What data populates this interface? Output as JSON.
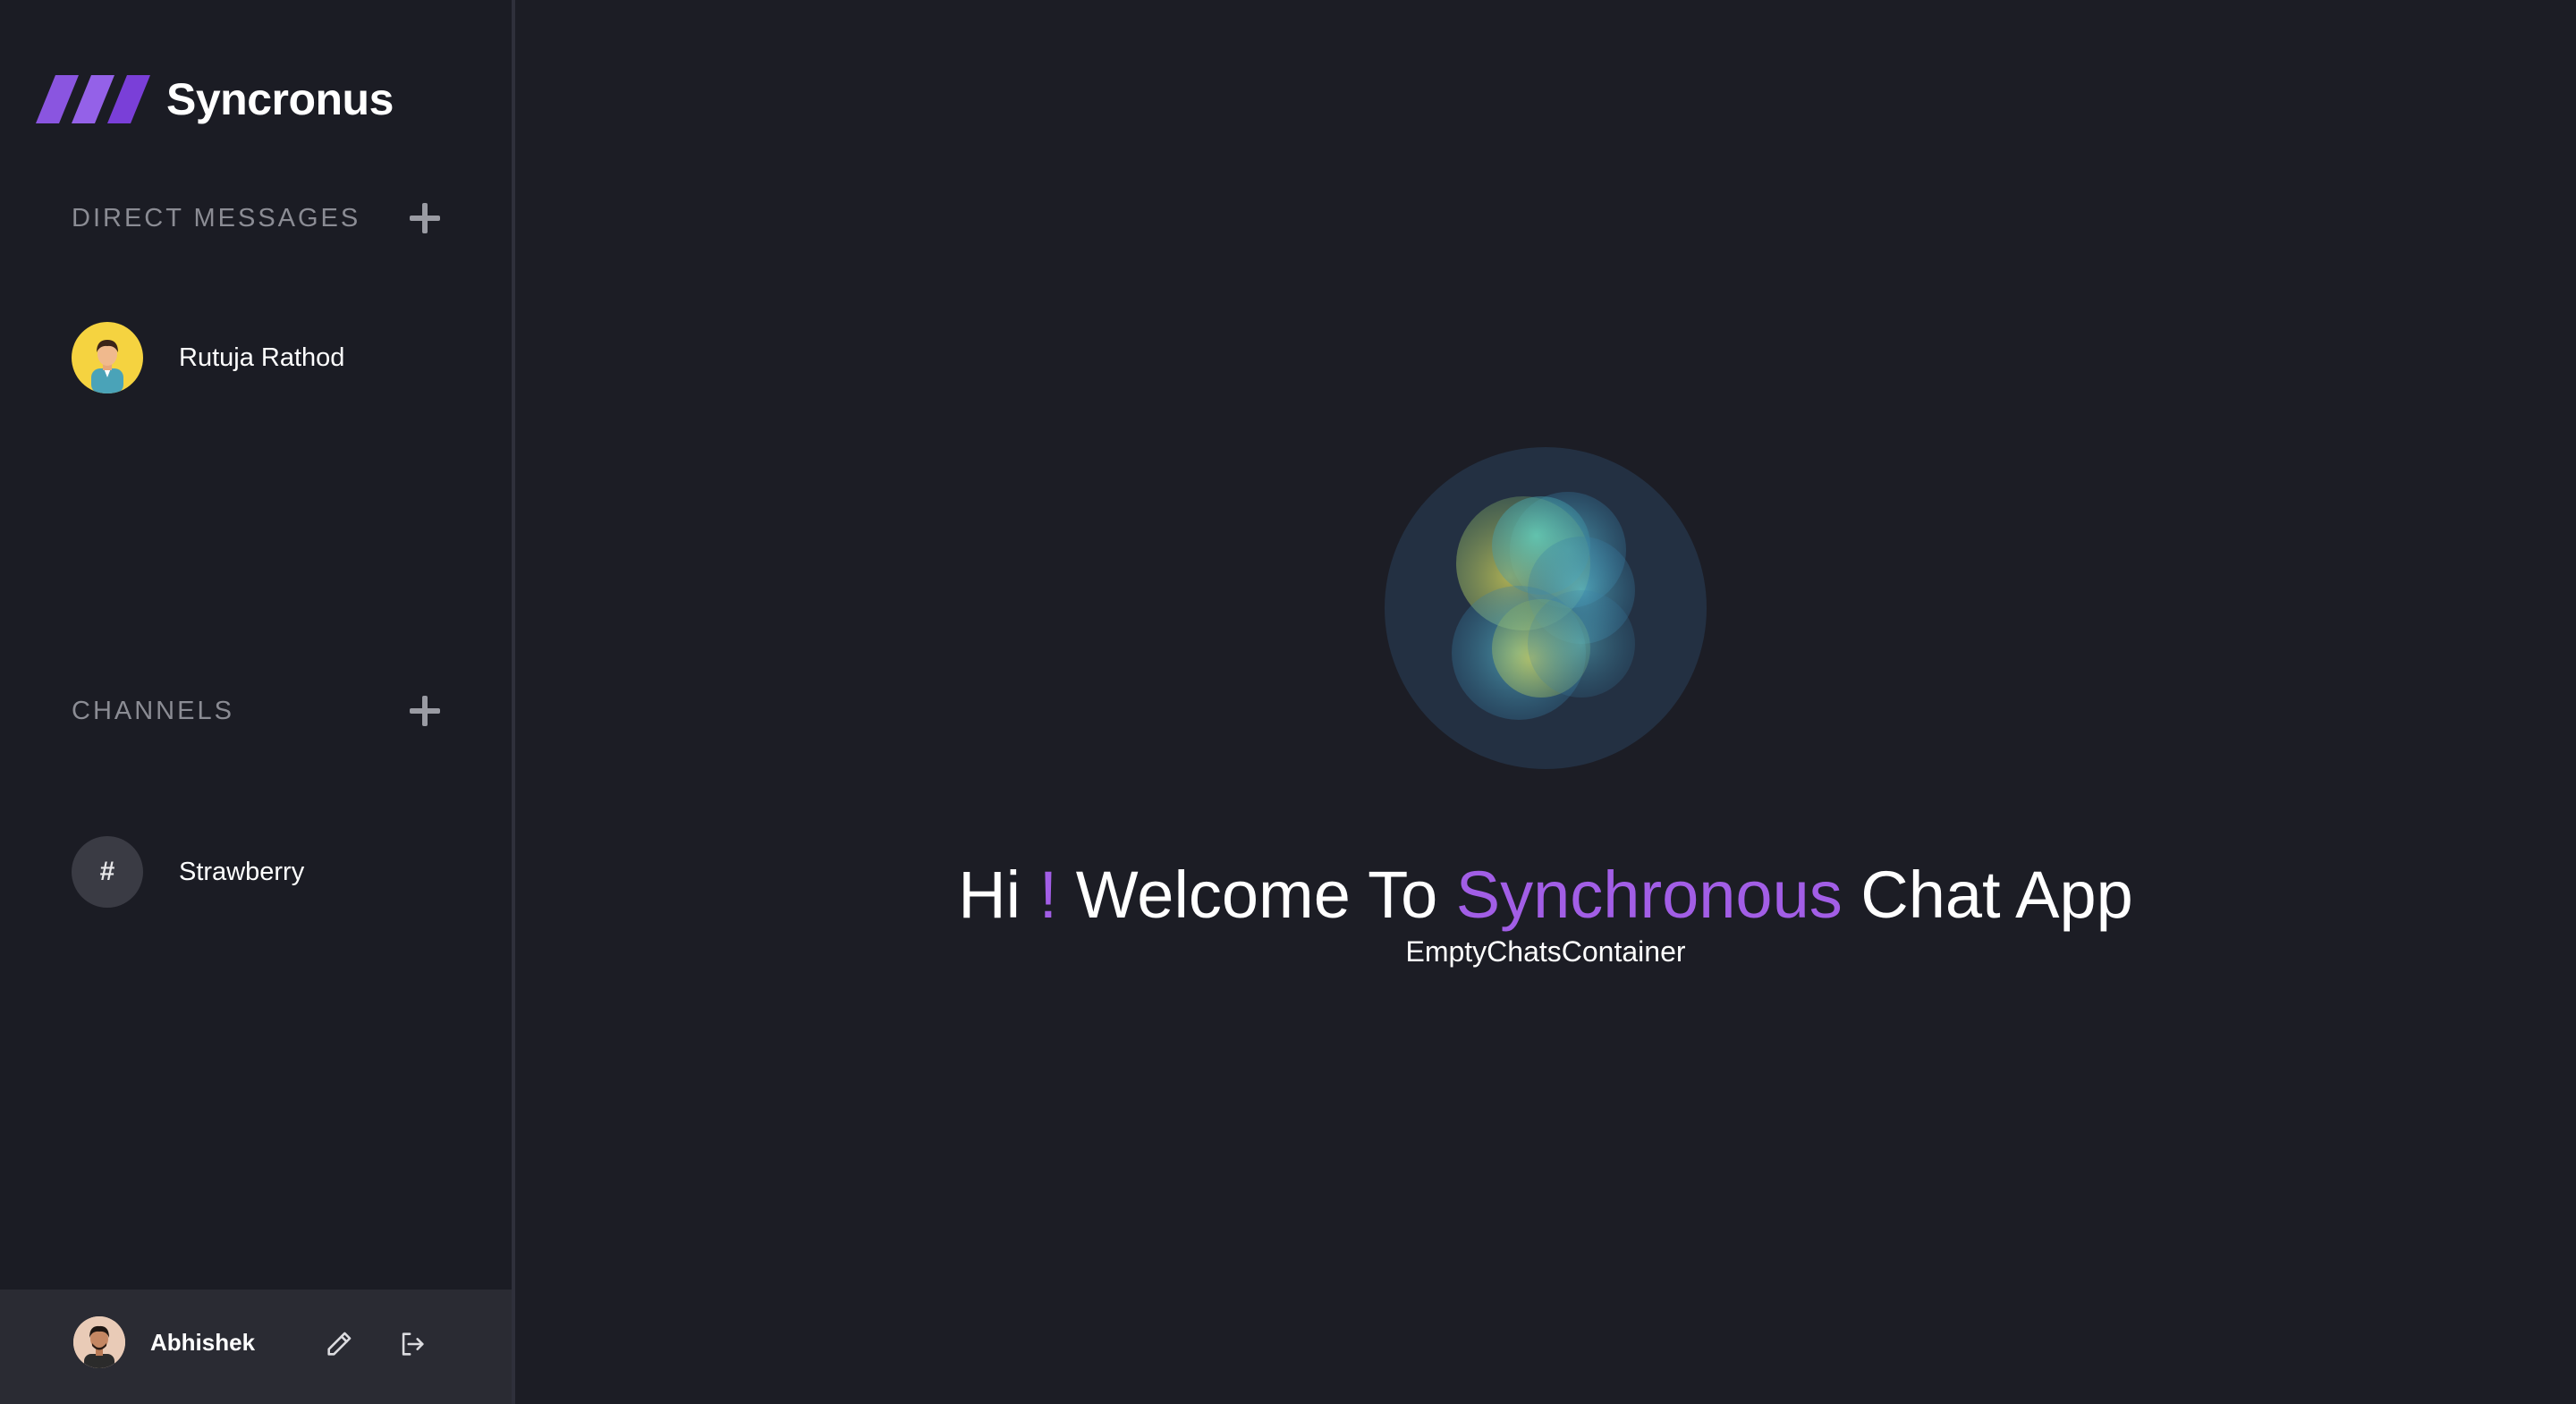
{
  "app": {
    "name": "Syncronus",
    "brand_color": "#8a4fe0",
    "accent_color": "#a25ee6",
    "background": "#1c1d25"
  },
  "sidebar": {
    "direct_messages": {
      "title": "DIRECT MESSAGES",
      "add_icon": "plus-icon",
      "items": [
        {
          "label": "Rutuja Rathod",
          "avatar": "cartoon-person-avatar"
        }
      ]
    },
    "channels": {
      "title": "CHANNELS",
      "add_icon": "plus-icon",
      "items": [
        {
          "label": "Strawberry",
          "symbol": "#"
        }
      ]
    },
    "profile": {
      "name": "Abhishek",
      "edit_icon": "pencil-icon",
      "logout_icon": "logout-icon"
    }
  },
  "main": {
    "welcome": {
      "part1": "Hi",
      "exclaim": "!",
      "part2": "Welcome To",
      "highlight": "Synchronous",
      "part3": "Chat App"
    },
    "subtitle": "EmptyChatsContainer",
    "hero_icon": "animated-orb-icon"
  }
}
